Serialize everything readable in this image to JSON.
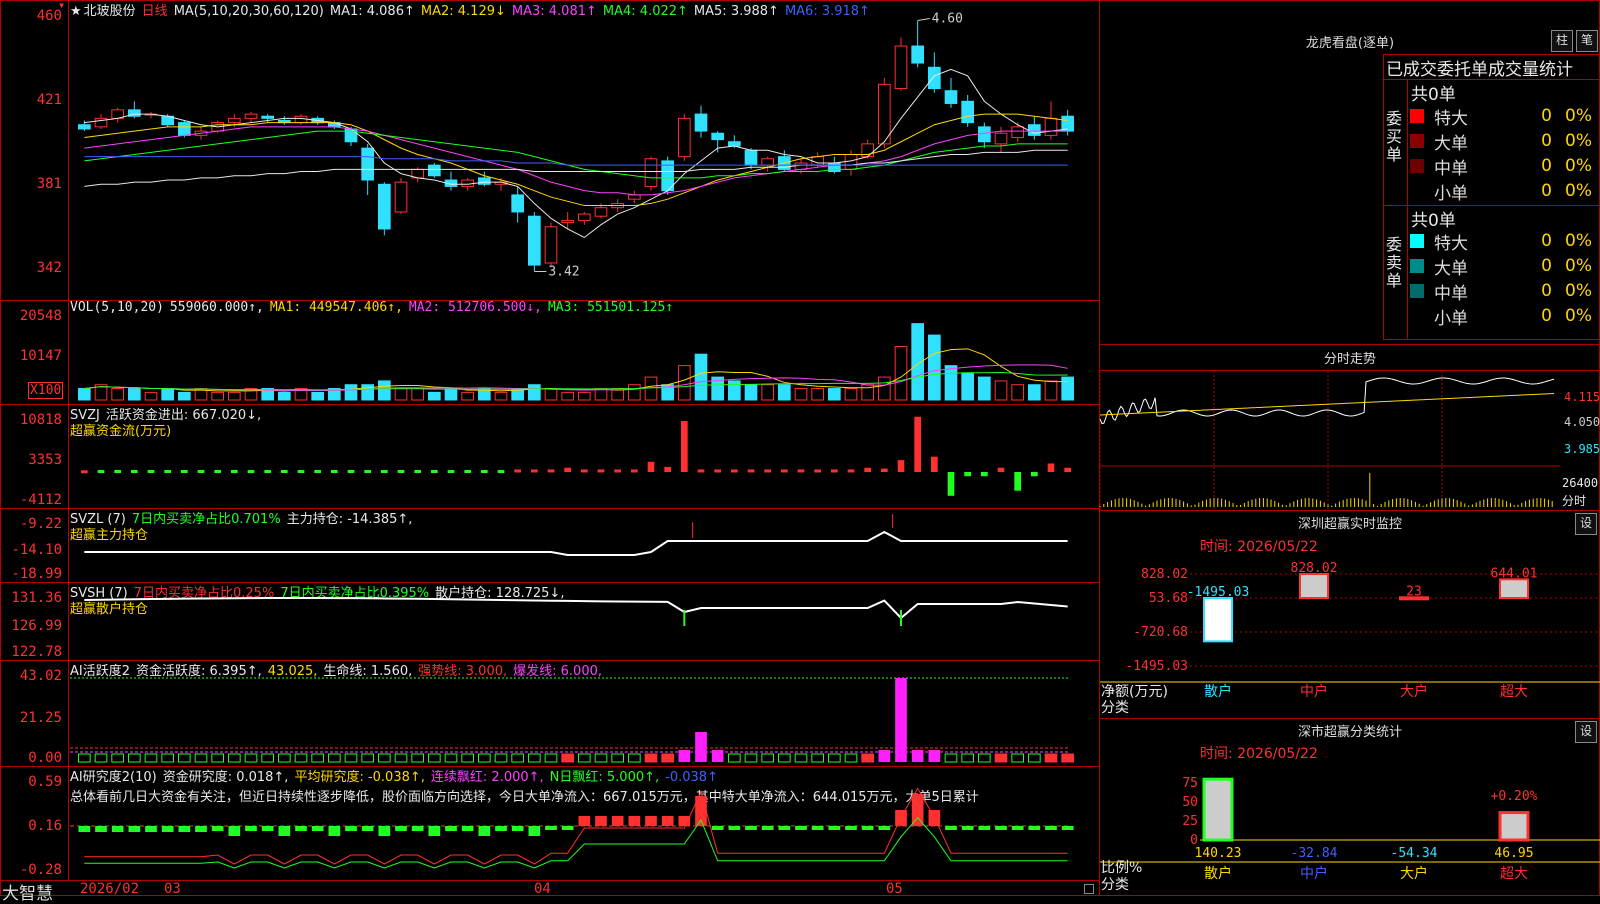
{
  "header": {
    "star": "★",
    "stock_name": "北玻股份",
    "period": "日线",
    "ma_label": "MA(5,10,20,30,60,120)",
    "ma": [
      {
        "label": "MA1: 4.086↑",
        "color": "#e8e8e8"
      },
      {
        "label": "MA2: 4.129↓",
        "color": "#ffd700"
      },
      {
        "label": "MA3: 4.081↑",
        "color": "#ff40ff"
      },
      {
        "label": "MA4: 4.022↑",
        "color": "#20ff20"
      },
      {
        "label": "MA5: 3.988↑",
        "color": "#e8e8e8"
      },
      {
        "label": "MA6: 3.918↑",
        "color": "#4060ff"
      }
    ],
    "close_marker": "▾"
  },
  "price_axis": [
    "460",
    "421",
    "381",
    "342"
  ],
  "price_annotations": {
    "high": "4.60",
    "low": "3.42"
  },
  "vol": {
    "title": "VOL(5,10,20)",
    "value": "559060.000↑,",
    "ma1": "MA1: 449547.406↑,",
    "ma2": "MA2: 512706.500↓,",
    "ma3": "MA3: 551501.125↑",
    "axis": [
      "20548",
      "10147"
    ],
    "unit": "X100"
  },
  "svzj": {
    "title": "SVZJ",
    "text1": "活跃资金进出: 667.020↓,",
    "text2": "超赢资金流(万元)",
    "axis": [
      "10818",
      "3353",
      "-4112"
    ]
  },
  "svzl": {
    "title": "SVZL (7)",
    "text1": "7日内买卖净占比0.701%",
    "text2": "主力持仓: -14.385↑,",
    "text3": "超赢主力持仓",
    "axis": [
      "-9.22",
      "-14.10",
      "-18.99"
    ]
  },
  "svsh": {
    "title": "SVSH (7)",
    "text1": "7日内买卖净占比0.25%",
    "text2": "7日内买卖净占比0.395%",
    "text3": "散户持仓: 128.725↓,",
    "text4": "超赢散户持仓",
    "axis": [
      "131.36",
      "126.99",
      "122.78"
    ]
  },
  "ai1": {
    "title": "AI活跃度2",
    "t1": "资金活跃度: 6.395↑,",
    "t2": "43.025,",
    "t3": "生命线: 1.560,",
    "t4": "强势线: 3.000,",
    "t5": "爆发线: 6.000,",
    "axis": [
      "43.02",
      "21.25",
      "0.00"
    ]
  },
  "ai2": {
    "title": "AI研究度2(10)",
    "t1": "资金研究度: 0.018↑,",
    "t2": "平均研究度: -0.038↑,",
    "t3": "连续飘红: 2.000↑,",
    "t4": "N日飘红: 5.000↑,",
    "t5": "-0.038↑",
    "summary": "总体看前几日大资金有关注，但近日持续性逐步降低，股价面临方向选择，今日大单净流入：667.015万元，其中特大单净流入：644.015万元，大单5日累计",
    "axis": [
      "0.59",
      "0.16",
      "-0.28"
    ]
  },
  "footer": {
    "logo": "大智慧",
    "dates": [
      "2026/02",
      "03",
      "04",
      "05"
    ]
  },
  "dragon_tiger": {
    "title": "龙虎看盘(逐单)",
    "btn_bar": "柱",
    "btn_pen": "笔",
    "subtitle": "已成交委托单成交量统计",
    "buy_label": "委买单",
    "sell_label": "委卖单",
    "buy_total": "共0单",
    "sell_total": "共0单",
    "buy_rows": [
      {
        "name": "特大",
        "count": "0",
        "pct": "0%",
        "color": "#ff0000"
      },
      {
        "name": "大单",
        "count": "0",
        "pct": "0%",
        "color": "#8b0000"
      },
      {
        "name": "中单",
        "count": "0",
        "pct": "0%",
        "color": "#6b0000"
      },
      {
        "name": "小单",
        "count": "0",
        "pct": "0%",
        "color": "#000000"
      }
    ],
    "sell_rows": [
      {
        "name": "特大",
        "count": "0",
        "pct": "0%",
        "color": "#00ffff"
      },
      {
        "name": "大单",
        "count": "0",
        "pct": "0%",
        "color": "#008b8b"
      },
      {
        "name": "中单",
        "count": "0",
        "pct": "0%",
        "color": "#006b6b"
      },
      {
        "name": "小单",
        "count": "0",
        "pct": "0%",
        "color": "#000000"
      }
    ]
  },
  "intraday": {
    "title": "分时走势",
    "axis": [
      "4.115",
      "4.050",
      "3.985"
    ],
    "vol_label": "26400",
    "vol_sub": "分时"
  },
  "monitor": {
    "title": "深圳超赢实时监控",
    "set": "设",
    "time": "时间: 2026/05/22",
    "axis": [
      "828.02",
      "53.68",
      "-720.68",
      "-1495.03"
    ],
    "ylabel": "净额(万元)",
    "xlabel": "分类",
    "categories": [
      {
        "name": "散户",
        "color": "#30e0ff"
      },
      {
        "name": "中户",
        "color": "#ff3030"
      },
      {
        "name": "大户",
        "color": "#ff3030"
      },
      {
        "name": "超大",
        "color": "#ff3030"
      }
    ],
    "bars": [
      {
        "value": -1495.03,
        "label": "-1495.03",
        "color": "#30e0ff"
      },
      {
        "value": 828.02,
        "label": "828.02",
        "color": "#ff3030"
      },
      {
        "value": 23,
        "label": "23",
        "color": "#ff3030"
      },
      {
        "value": 644.01,
        "label": "644.01",
        "color": "#ff3030"
      }
    ]
  },
  "classify": {
    "title": "深市超赢分类统计",
    "set": "设",
    "time": "时间: 2026/05/22",
    "axis": [
      "75",
      "50",
      "25",
      "0"
    ],
    "ylabel": "比例%",
    "xlabel": "分类",
    "pct_label": "+0.20%",
    "categories": [
      {
        "name": "散户",
        "color": "#ffd700"
      },
      {
        "name": "中户",
        "color": "#4060ff"
      },
      {
        "name": "大户",
        "color": "#ffd700"
      },
      {
        "name": "超大",
        "color": "#ff3030"
      }
    ],
    "values": [
      {
        "label": "140.23",
        "color": "#ffd700"
      },
      {
        "label": "-32.84",
        "color": "#4060ff"
      },
      {
        "label": "-54.34",
        "color": "#30e0ff"
      },
      {
        "label": "46.95",
        "color": "#ffd700"
      }
    ],
    "bars": [
      80,
      0,
      0,
      38
    ]
  },
  "chart_data": {
    "type": "candlestick",
    "ohlc": [
      [
        4.11,
        4.13,
        4.08,
        4.09
      ],
      [
        4.1,
        4.16,
        4.09,
        4.14
      ],
      [
        4.14,
        4.19,
        4.12,
        4.18
      ],
      [
        4.18,
        4.22,
        4.14,
        4.15
      ],
      [
        4.16,
        4.17,
        4.14,
        4.16
      ],
      [
        4.15,
        4.16,
        4.1,
        4.11
      ],
      [
        4.12,
        4.13,
        4.05,
        4.06
      ],
      [
        4.06,
        4.1,
        4.04,
        4.08
      ],
      [
        4.08,
        4.13,
        4.07,
        4.12
      ],
      [
        4.12,
        4.16,
        4.1,
        4.14
      ],
      [
        4.14,
        4.17,
        4.12,
        4.16
      ],
      [
        4.15,
        4.16,
        4.12,
        4.14
      ],
      [
        4.13,
        4.15,
        4.11,
        4.12
      ],
      [
        4.12,
        4.16,
        4.11,
        4.15
      ],
      [
        4.14,
        4.15,
        4.11,
        4.12
      ],
      [
        4.12,
        4.13,
        4.09,
        4.1
      ],
      [
        4.09,
        4.1,
        4.01,
        4.03
      ],
      [
        4.0,
        4.02,
        3.78,
        3.85
      ],
      [
        3.83,
        3.84,
        3.59,
        3.62
      ],
      [
        3.7,
        3.86,
        3.69,
        3.84
      ],
      [
        3.86,
        3.91,
        3.84,
        3.9
      ],
      [
        3.92,
        3.93,
        3.86,
        3.87
      ],
      [
        3.85,
        3.89,
        3.8,
        3.82
      ],
      [
        3.82,
        3.86,
        3.8,
        3.85
      ],
      [
        3.86,
        3.89,
        3.82,
        3.83
      ],
      [
        3.83,
        3.86,
        3.8,
        3.84
      ],
      [
        3.78,
        3.82,
        3.65,
        3.7
      ],
      [
        3.68,
        3.7,
        3.42,
        3.45
      ],
      [
        3.46,
        3.65,
        3.44,
        3.63
      ],
      [
        3.65,
        3.7,
        3.62,
        3.66
      ],
      [
        3.66,
        3.7,
        3.64,
        3.69
      ],
      [
        3.68,
        3.74,
        3.67,
        3.72
      ],
      [
        3.72,
        3.76,
        3.7,
        3.74
      ],
      [
        3.76,
        3.8,
        3.74,
        3.78
      ],
      [
        3.82,
        3.96,
        3.8,
        3.95
      ],
      [
        3.94,
        3.96,
        3.78,
        3.8
      ],
      [
        3.96,
        4.16,
        3.94,
        4.14
      ],
      [
        4.16,
        4.2,
        4.05,
        4.08
      ],
      [
        4.07,
        4.08,
        3.98,
        4.04
      ],
      [
        4.03,
        4.06,
        4.0,
        4.01
      ],
      [
        3.99,
        4.0,
        3.9,
        3.92
      ],
      [
        3.92,
        3.96,
        3.89,
        3.95
      ],
      [
        3.96,
        3.99,
        3.89,
        3.9
      ],
      [
        3.9,
        3.95,
        3.88,
        3.93
      ],
      [
        3.92,
        3.98,
        3.91,
        3.96
      ],
      [
        3.93,
        3.96,
        3.88,
        3.89
      ],
      [
        3.9,
        3.99,
        3.87,
        3.97
      ],
      [
        3.96,
        4.04,
        3.95,
        4.02
      ],
      [
        4.02,
        4.33,
        4.0,
        4.3
      ],
      [
        4.28,
        4.52,
        4.27,
        4.48
      ],
      [
        4.48,
        4.6,
        4.38,
        4.4
      ],
      [
        4.38,
        4.45,
        4.26,
        4.28
      ],
      [
        4.27,
        4.33,
        4.19,
        4.21
      ],
      [
        4.22,
        4.25,
        4.1,
        4.12
      ],
      [
        4.1,
        4.12,
        4.0,
        4.03
      ],
      [
        4.02,
        4.1,
        3.98,
        4.07
      ],
      [
        4.05,
        4.12,
        4.03,
        4.1
      ],
      [
        4.11,
        4.15,
        4.04,
        4.06
      ],
      [
        4.06,
        4.22,
        4.04,
        4.14
      ],
      [
        4.15,
        4.18,
        4.06,
        4.08
      ]
    ],
    "volume": [
      3,
      4,
      3,
      3,
      2,
      3,
      2,
      3,
      2,
      2,
      3,
      3,
      2,
      3,
      2,
      3,
      4,
      4,
      5,
      3,
      3,
      2,
      3,
      2,
      3,
      2,
      3,
      4,
      3,
      2,
      2,
      3,
      3,
      4,
      6,
      4,
      9,
      12,
      6,
      5,
      4,
      4,
      4,
      3,
      3,
      3,
      3,
      4,
      6,
      14,
      20,
      17,
      9,
      7,
      6,
      5,
      4,
      4,
      5,
      6
    ],
    "svzj": [
      0.2,
      0.1,
      0.1,
      0.1,
      0.1,
      0.1,
      0.1,
      0.1,
      0.1,
      0.1,
      0.1,
      0.1,
      0.1,
      0.1,
      0.1,
      0.1,
      0.1,
      0.1,
      0.1,
      0.1,
      0.1,
      0.1,
      0.1,
      0.1,
      0.1,
      0.1,
      0.3,
      0.3,
      0.3,
      0.5,
      0.3,
      0.3,
      0.3,
      0.3,
      1.2,
      0.6,
      6,
      0.3,
      0.3,
      0.3,
      0.3,
      0.3,
      0.3,
      0.3,
      0.3,
      0.3,
      0.3,
      0.5,
      0.4,
      1.4,
      6.5,
      1.8,
      -2.8,
      -0.5,
      -0.5,
      0.5,
      -2.2,
      -0.5,
      1.0,
      0.5
    ],
    "ma_lines": {
      "ma1": [
        4.12,
        4.13,
        4.14,
        4.16,
        4.16,
        4.15,
        4.13,
        4.11,
        4.1,
        4.11,
        4.12,
        4.13,
        4.14,
        4.14,
        4.13,
        4.12,
        4.09,
        4.03,
        3.93,
        3.88,
        3.86,
        3.85,
        3.83,
        3.83,
        3.84,
        3.84,
        3.82,
        3.74,
        3.67,
        3.62,
        3.58,
        3.64,
        3.69,
        3.72,
        3.76,
        3.8,
        3.88,
        3.94,
        4.0,
        4.01,
        3.99,
        3.99,
        3.97,
        3.96,
        3.93,
        3.93,
        3.94,
        3.96,
        4.03,
        4.14,
        4.24,
        4.34,
        4.37,
        4.34,
        4.22,
        4.16,
        4.11,
        4.07,
        4.08,
        4.09
      ],
      "ma2": [
        4.05,
        4.06,
        4.07,
        4.08,
        4.09,
        4.1,
        4.1,
        4.1,
        4.11,
        4.11,
        4.11,
        4.12,
        4.12,
        4.12,
        4.12,
        4.12,
        4.11,
        4.08,
        4.04,
        4.0,
        3.97,
        3.95,
        3.93,
        3.9,
        3.87,
        3.85,
        3.83,
        3.8,
        3.77,
        3.75,
        3.73,
        3.73,
        3.73,
        3.73,
        3.74,
        3.76,
        3.79,
        3.82,
        3.85,
        3.87,
        3.89,
        3.91,
        3.93,
        3.95,
        3.96,
        3.97,
        3.97,
        3.97,
        3.99,
        4.03,
        4.07,
        4.11,
        4.13,
        4.15,
        4.16,
        4.16,
        4.16,
        4.15,
        4.14,
        4.13
      ],
      "ma3": [
        4.0,
        4.01,
        4.02,
        4.03,
        4.04,
        4.05,
        4.06,
        4.07,
        4.08,
        4.09,
        4.1,
        4.1,
        4.1,
        4.1,
        4.1,
        4.1,
        4.09,
        4.08,
        4.06,
        4.04,
        4.02,
        4.0,
        3.98,
        3.96,
        3.94,
        3.92,
        3.9,
        3.87,
        3.84,
        3.82,
        3.8,
        3.79,
        3.79,
        3.78,
        3.78,
        3.79,
        3.8,
        3.82,
        3.84,
        3.86,
        3.87,
        3.88,
        3.89,
        3.9,
        3.91,
        3.92,
        3.92,
        3.93,
        3.94,
        3.96,
        3.99,
        4.02,
        4.04,
        4.06,
        4.07,
        4.08,
        4.08,
        4.08,
        4.08,
        4.08
      ],
      "ma4": [
        3.94,
        3.95,
        3.96,
        3.97,
        3.98,
        3.99,
        4.0,
        4.01,
        4.02,
        4.03,
        4.04,
        4.05,
        4.06,
        4.07,
        4.08,
        4.08,
        4.08,
        4.07,
        4.06,
        4.05,
        4.04,
        4.03,
        4.02,
        4.01,
        4.0,
        3.99,
        3.98,
        3.96,
        3.94,
        3.92,
        3.9,
        3.89,
        3.88,
        3.87,
        3.86,
        3.86,
        3.86,
        3.86,
        3.87,
        3.87,
        3.88,
        3.88,
        3.89,
        3.89,
        3.89,
        3.9,
        3.9,
        3.91,
        3.92,
        3.94,
        3.96,
        3.98,
        3.99,
        4.0,
        4.01,
        4.01,
        4.02,
        4.02,
        4.02,
        4.02
      ],
      "ma5": [
        3.82,
        3.83,
        3.83,
        3.84,
        3.84,
        3.85,
        3.85,
        3.86,
        3.86,
        3.87,
        3.87,
        3.88,
        3.88,
        3.89,
        3.89,
        3.9,
        3.9,
        3.9,
        3.9,
        3.9,
        3.9,
        3.9,
        3.9,
        3.9,
        3.9,
        3.9,
        3.9,
        3.89,
        3.89,
        3.89,
        3.89,
        3.89,
        3.89,
        3.89,
        3.89,
        3.89,
        3.89,
        3.9,
        3.9,
        3.9,
        3.91,
        3.91,
        3.91,
        3.92,
        3.92,
        3.92,
        3.92,
        3.93,
        3.93,
        3.94,
        3.95,
        3.96,
        3.97,
        3.97,
        3.98,
        3.98,
        3.98,
        3.99,
        3.99,
        3.99
      ],
      "ma6": [
        3.96,
        3.96,
        3.96,
        3.96,
        3.96,
        3.96,
        3.96,
        3.96,
        3.96,
        3.96,
        3.96,
        3.96,
        3.96,
        3.96,
        3.96,
        3.96,
        3.96,
        3.96,
        3.95,
        3.95,
        3.95,
        3.95,
        3.94,
        3.94,
        3.94,
        3.94,
        3.93,
        3.93,
        3.93,
        3.92,
        3.92,
        3.92,
        3.92,
        3.92,
        3.92,
        3.92,
        3.92,
        3.92,
        3.92,
        3.92,
        3.92,
        3.92,
        3.92,
        3.92,
        3.92,
        3.92,
        3.92,
        3.92,
        3.92,
        3.92,
        3.92,
        3.92,
        3.92,
        3.92,
        3.92,
        3.92,
        3.92,
        3.92,
        3.92,
        3.92
      ]
    }
  }
}
